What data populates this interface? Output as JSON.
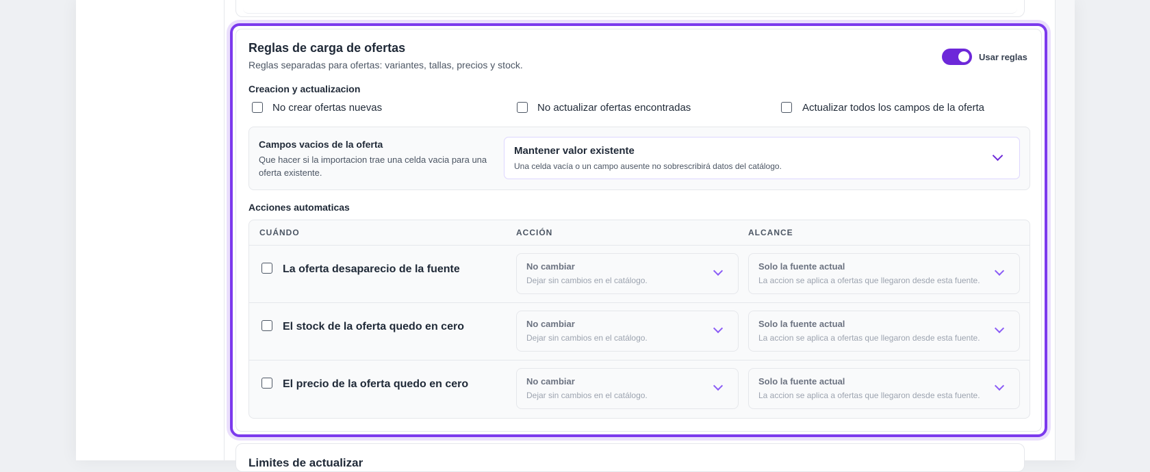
{
  "rules": {
    "title": "Reglas de carga de ofertas",
    "subtitle": "Reglas separadas para ofertas: variantes, tallas, precios y stock.",
    "toggle_label": "Usar reglas",
    "toggle_on": true,
    "accent_color": "#7c3aed",
    "creation": {
      "label": "Creacion y actualizacion",
      "options": [
        {
          "label": "No crear ofertas nuevas",
          "checked": false
        },
        {
          "label": "No actualizar ofertas encontradas",
          "checked": false
        },
        {
          "label": "Actualizar todos los campos de la oferta",
          "checked": false
        }
      ]
    },
    "empty_fields": {
      "title": "Campos vacios de la oferta",
      "description": "Que hacer si la importacion trae una celda vacia para una oferta existente.",
      "select_value": "Mantener valor existente",
      "select_desc": "Una celda vacía o un campo ausente no sobrescribirá datos del catálogo."
    },
    "actions": {
      "label": "Acciones automaticas",
      "headers": {
        "when": "CUÁNDO",
        "action": "ACCIÓN",
        "scope": "ALCANCE"
      },
      "rows": [
        {
          "label": "La oferta desaparecio de la fuente",
          "checked": false,
          "action_title": "No cambiar",
          "action_desc": "Dejar sin cambios en el catálogo.",
          "scope_title": "Solo la fuente actual",
          "scope_desc": "La accion se aplica a ofertas que llegaron desde esta fuente."
        },
        {
          "label": "El stock de la oferta quedo en cero",
          "checked": false,
          "action_title": "No cambiar",
          "action_desc": "Dejar sin cambios en el catálogo.",
          "scope_title": "Solo la fuente actual",
          "scope_desc": "La accion se aplica a ofertas que llegaron desde esta fuente."
        },
        {
          "label": "El precio de la oferta quedo en cero",
          "checked": false,
          "action_title": "No cambiar",
          "action_desc": "Dejar sin cambios en el catálogo.",
          "scope_title": "Solo la fuente actual",
          "scope_desc": "La accion se aplica a ofertas que llegaron desde esta fuente."
        }
      ]
    }
  },
  "next_section": {
    "title": "Limites de actualizar"
  }
}
